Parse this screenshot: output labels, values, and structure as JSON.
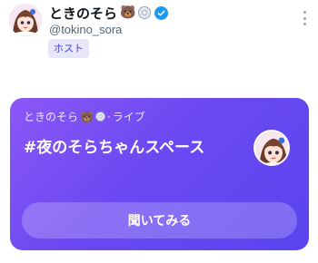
{
  "profile": {
    "name": "ときのそら",
    "emoji": "🐻",
    "handle": "@tokino_sora",
    "role": "ホスト"
  },
  "space": {
    "subtitle_name": "ときのそら",
    "subtitle_emoji": "🐻",
    "subtitle_sep": "·",
    "subtitle_status": "ライブ",
    "title": "#夜のそらちゃんスペース",
    "listen_label": "聞いてみる"
  },
  "colors": {
    "card_gradient_start": "#8c57f6",
    "card_gradient_end": "#5a44ee",
    "verified_blue": "#1d9bf0",
    "badge_bg": "#e8e6fb",
    "badge_text": "#4b3fce"
  },
  "icons": {
    "verified": "verified-badge-icon",
    "more": "more-vertical-icon",
    "disc": "disc-emoji-icon"
  }
}
